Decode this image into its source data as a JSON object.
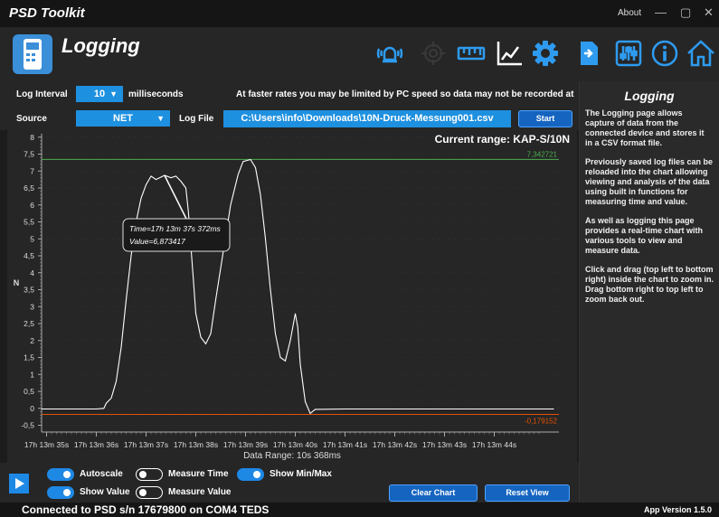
{
  "window": {
    "title": "PSD Toolkit",
    "about": "About",
    "minimize": "—",
    "maximize": "▢",
    "close": "✕"
  },
  "header": {
    "page_title": "Logging"
  },
  "toolbar": {
    "icons": [
      "alarm-icon",
      "target-icon",
      "ruler-icon",
      "chart-line-icon",
      "gear-icon",
      "export-icon",
      "sliders-icon",
      "info-icon",
      "home-icon"
    ]
  },
  "controls": {
    "log_interval_label": "Log Interval",
    "log_interval_value": "10",
    "interval_unit": "milliseconds",
    "warning": "At faster rates you may be limited by PC speed so data may not be recorded at required ra",
    "source_label": "Source",
    "source_value": "NET",
    "log_file_label": "Log File",
    "log_file_path": "C:\\Users\\info\\Downloads\\10N-Druck-Messung001.csv",
    "start_logging": "Start Logging"
  },
  "chart": {
    "current_range": "Current range:  KAP-S/10N",
    "data_range": "Data Range: 10s 368ms",
    "max_label": "7,342721",
    "min_label": "-0,179152",
    "tooltip_time": "Time=17h 13m 37s 372ms",
    "tooltip_value": "Value=6,873417",
    "colors": {
      "max": "#4caf50",
      "min": "#e65100",
      "line": "#ffffff"
    }
  },
  "chart_data": {
    "type": "line",
    "title": "",
    "ylabel": "N",
    "xlabel": "Data Range: 10s 368ms",
    "ylim": [
      -0.7,
      8.1
    ],
    "xlim": [
      34.9,
      45.3
    ],
    "yticks": [
      "8",
      "7,5",
      "7",
      "6,5",
      "6",
      "5,5",
      "5",
      "4,5",
      "4",
      "3,5",
      "3",
      "2,5",
      "2",
      "1,5",
      "1",
      "0,5",
      "0",
      "-0,5"
    ],
    "ytick_values": [
      8,
      7.5,
      7,
      6.5,
      6,
      5.5,
      5,
      4.5,
      4,
      3.5,
      3,
      2.5,
      2,
      1.5,
      1,
      0.5,
      0,
      -0.5
    ],
    "xticks": [
      "17h 13m 35s",
      "17h 13m 36s",
      "17h 13m 37s",
      "17h 13m 38s",
      "17h 13m 39s",
      "17h 13m 40s",
      "17h 13m 41s",
      "17h 13m 42s",
      "17h 13m 43s",
      "17h 13m 44s"
    ],
    "xtick_values": [
      35,
      36,
      37,
      38,
      39,
      40,
      41,
      42,
      43,
      44
    ],
    "max_line": 7.342721,
    "min_line": -0.179152,
    "series": [
      {
        "values": [
          [
            34.9,
            -0.02
          ],
          [
            35.5,
            -0.02
          ],
          [
            36.0,
            -0.02
          ],
          [
            36.15,
            0.0
          ],
          [
            36.2,
            0.15
          ],
          [
            36.3,
            0.3
          ],
          [
            36.4,
            0.8
          ],
          [
            36.5,
            1.8
          ],
          [
            36.6,
            3.2
          ],
          [
            36.7,
            4.5
          ],
          [
            36.8,
            5.5
          ],
          [
            36.9,
            6.2
          ],
          [
            37.0,
            6.6
          ],
          [
            37.1,
            6.85
          ],
          [
            37.2,
            6.75
          ],
          [
            37.372,
            6.873
          ],
          [
            37.5,
            6.8
          ],
          [
            37.6,
            6.85
          ],
          [
            37.7,
            6.7
          ],
          [
            37.8,
            6.5
          ],
          [
            37.85,
            5.8
          ],
          [
            37.9,
            4.8
          ],
          [
            37.95,
            3.8
          ],
          [
            38.0,
            2.8
          ],
          [
            38.1,
            2.1
          ],
          [
            38.2,
            1.9
          ],
          [
            38.3,
            2.2
          ],
          [
            38.4,
            3.2
          ],
          [
            38.55,
            4.6
          ],
          [
            38.7,
            6.0
          ],
          [
            38.85,
            6.9
          ],
          [
            38.95,
            7.28
          ],
          [
            39.1,
            7.34
          ],
          [
            39.2,
            7.1
          ],
          [
            39.3,
            6.3
          ],
          [
            39.4,
            5.0
          ],
          [
            39.5,
            3.5
          ],
          [
            39.6,
            2.2
          ],
          [
            39.7,
            1.5
          ],
          [
            39.8,
            1.4
          ],
          [
            39.9,
            2.0
          ],
          [
            40.0,
            2.8
          ],
          [
            40.05,
            2.4
          ],
          [
            40.1,
            1.3
          ],
          [
            40.2,
            0.2
          ],
          [
            40.3,
            -0.15
          ],
          [
            40.4,
            -0.03
          ],
          [
            41.0,
            -0.02
          ],
          [
            42.0,
            -0.02
          ],
          [
            43.0,
            -0.02
          ],
          [
            44.0,
            -0.02
          ],
          [
            45.2,
            -0.02
          ]
        ]
      }
    ]
  },
  "help": {
    "title": "Logging",
    "paragraphs": [
      "The Logging page allows capture of data from the connected device and stores it in a CSV format file.",
      "Previously saved log files can be reloaded into the chart allowing viewing and analysis of the data using built in functions for measuring time and value.",
      "As well as logging this page provides a real-time chart with various tools to view and measure data.",
      "Click and drag (top left to bottom right) inside the chart to zoom in. Drag bottom right to top left to zoom back out."
    ]
  },
  "options": {
    "autoscale": {
      "label": "Autoscale",
      "on": true
    },
    "show_value": {
      "label": "Show Value",
      "on": true
    },
    "measure_time": {
      "label": "Measure Time",
      "on": false
    },
    "measure_value": {
      "label": "Measure Value",
      "on": false
    },
    "show_minmax": {
      "label": "Show Min/Max",
      "on": true
    },
    "clear_chart": "Clear Chart",
    "reset_view": "Reset View"
  },
  "status": {
    "connection": "Connected to PSD s/n 17679800 on COM4   TEDS",
    "version": "App Version 1.5.0"
  }
}
